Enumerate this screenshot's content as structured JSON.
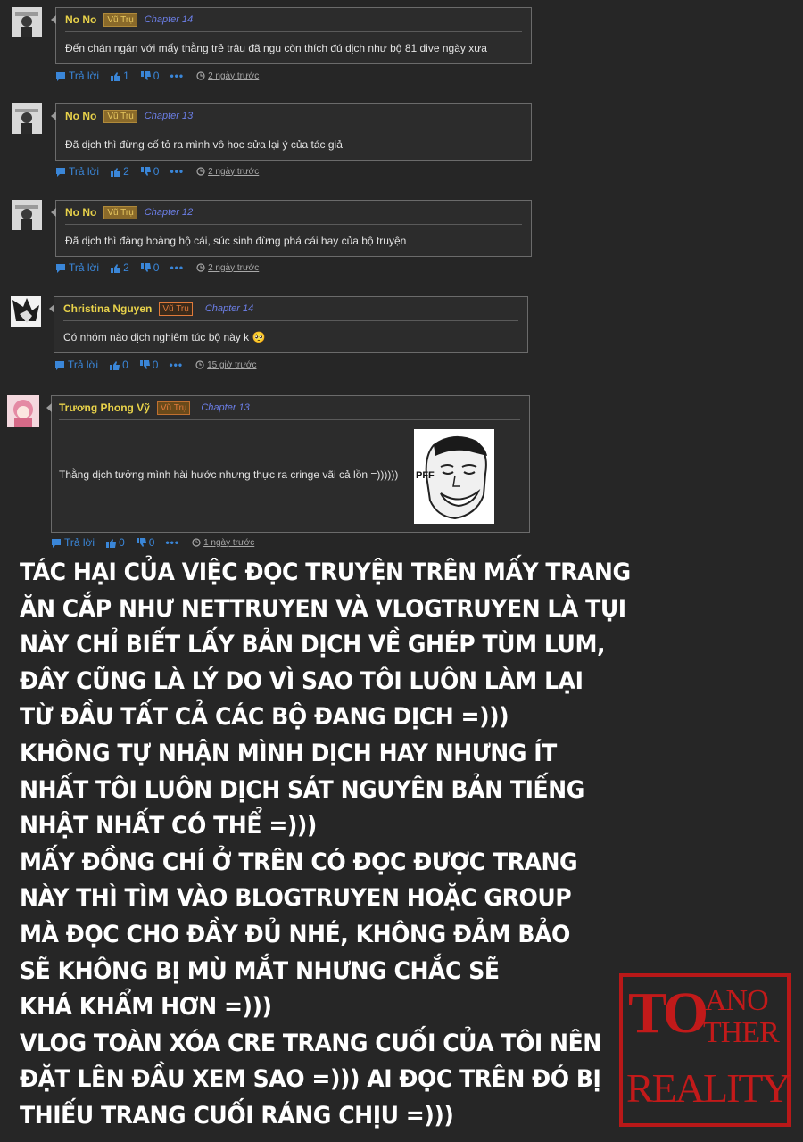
{
  "comments": [
    {
      "user": "No No",
      "rank": "Vũ Trụ",
      "chapter": "Chapter 14",
      "text": "Đến chán ngán với mấy thằng trẻ trâu đã ngu còn thích đú dịch như bộ 81 dive ngày xưa",
      "reply": "Trả lời",
      "likes": "1",
      "dislikes": "0",
      "time": "2 ngày trước"
    },
    {
      "user": "No No",
      "rank": "Vũ Trụ",
      "chapter": "Chapter 13",
      "text": "Đã dịch thì đừng cố tỏ ra mình vô học sửa lại ý của tác giả",
      "reply": "Trả lời",
      "likes": "2",
      "dislikes": "0",
      "time": "2 ngày trước"
    },
    {
      "user": "No No",
      "rank": "Vũ Trụ",
      "chapter": "Chapter 12",
      "text": "Đã dịch thì đàng hoàng hộ cái, súc sinh đừng phá cái hay của bộ truyện",
      "reply": "Trả lời",
      "likes": "2",
      "dislikes": "0",
      "time": "2 ngày trước"
    },
    {
      "user": "Christina Nguyen",
      "rank": "Vũ Trụ",
      "chapter": "Chapter 14",
      "text": "Có nhóm nào dịch nghiêm túc bộ này k 🥺",
      "reply": "Trả lời",
      "likes": "0",
      "dislikes": "0",
      "time": "15 giờ trước"
    },
    {
      "user": "Trương Phong Vỹ",
      "rank": "Vũ Trụ",
      "chapter": "Chapter 13",
      "text": "Thằng dịch tưởng mình hài hước nhưng thực ra cringe vãi cả lồn =))))))",
      "meme_text": "PFF",
      "reply": "Trả lời",
      "likes": "0",
      "dislikes": "0",
      "time": "1 ngày trước"
    }
  ],
  "note_lines": [
    "Tác hại của việc đọc truyện trên mấy trang",
    "ăn cắp như nettruyen và vlogtruyen là tụi",
    "này chỉ biết lấy bản dịch về ghép tùm lum,",
    "đây cũng là lý do vì sao tôi luôn làm lại",
    "từ đầu tất cả các bộ đang dịch =)))",
    "không tự nhận mình dịch hay nhưng ít",
    "nhất tôi luôn dịch sát nguyên bản tiếng",
    "nhật nhất có thể =)))",
    "mấy đồng chí ở trên có đọc được trang",
    "này thì tìm vào blogtruyen hoặc group",
    "mà đọc cho đầy đủ nhé, không đảm bảo",
    "sẽ không bị mù mắt nhưng chắc sẽ",
    "khá khẩm hơn =)))",
    "vlog toàn xóa cre trang cuối của tôi nên",
    "đặt lên đầu xem sao =))) ai đọc trên đó bị",
    "thiếu trang cuối ráng chịu =)))"
  ],
  "stamp": {
    "to": "TO",
    "ano": "ANO",
    "ther": "THER",
    "reality": "REALITY"
  },
  "colors": {
    "username": "#e8d24a",
    "chapter": "#6c7fe8",
    "action": "#3a86d8",
    "stamp": "#c21a1a"
  },
  "icons": [
    "comment-icon",
    "thumbs-up-icon",
    "thumbs-down-icon",
    "more-dots-icon",
    "clock-icon"
  ]
}
